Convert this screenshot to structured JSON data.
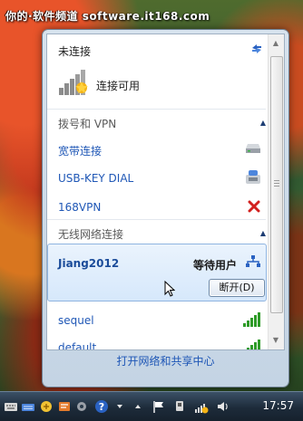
{
  "watermark": "你的·软件频道 software.it168.com",
  "status": {
    "title": "未连接",
    "available": "连接可用"
  },
  "dialup_section": {
    "header": "拨号和 VPN",
    "items": [
      {
        "label": "宽带连接",
        "icon": "modem-icon"
      },
      {
        "label": "USB-KEY DIAL",
        "icon": "dialup-phone-icon"
      },
      {
        "label": "168VPN",
        "icon": "disconnected-x-icon"
      }
    ]
  },
  "wireless_section": {
    "header": "无线网络连接",
    "selected": {
      "ssid": "Jiang2012",
      "status": "等待用户",
      "disconnect_label": "断开(D)"
    },
    "others": [
      {
        "label": "sequel",
        "icon": "signal-strength-icon"
      },
      {
        "label": "default",
        "icon": "signal-strength-icon"
      }
    ]
  },
  "footer": {
    "link": "打开网络和共享中心"
  },
  "taskbar": {
    "clock": "17:57"
  },
  "colors": {
    "link": "#1f57b6",
    "signal_green": "#2e9b28",
    "disconnected_red": "#d2201e",
    "selection_border": "#8fb4e0"
  }
}
